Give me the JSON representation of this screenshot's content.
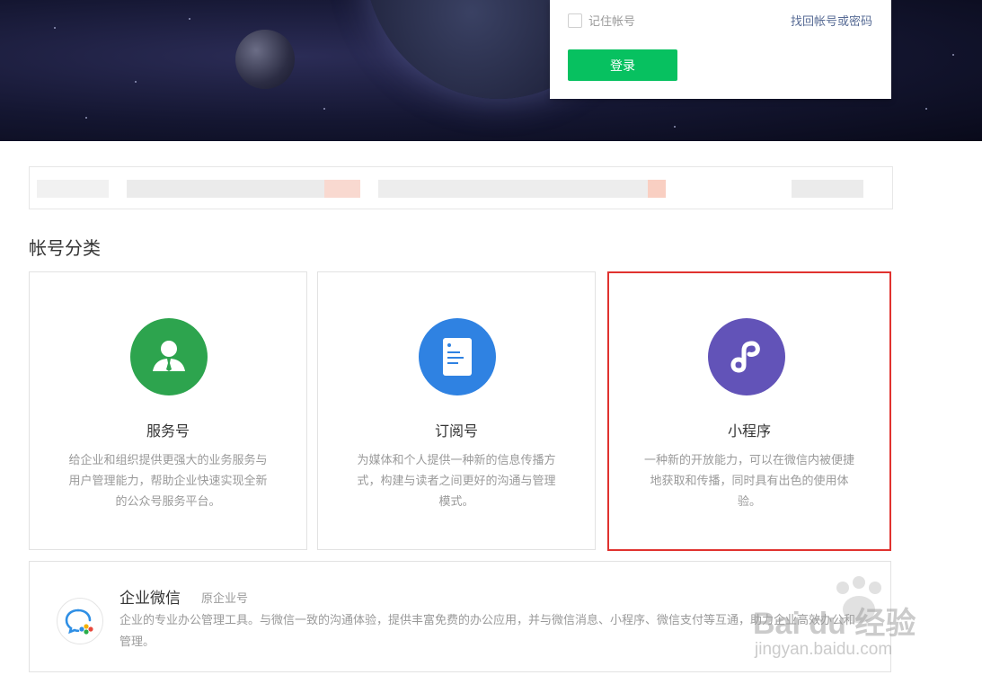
{
  "login": {
    "remember_label": "记住帐号",
    "recover_link": "找回帐号或密码",
    "login_button": "登录"
  },
  "section": {
    "title": "帐号分类"
  },
  "cards": [
    {
      "title": "服务号",
      "desc": "给企业和组织提供更强大的业务服务与用户管理能力，帮助企业快速实现全新的公众号服务平台。",
      "icon": "service-account-icon",
      "color": "#2da44e"
    },
    {
      "title": "订阅号",
      "desc": "为媒体和个人提供一种新的信息传播方式，构建与读者之间更好的沟通与管理模式。",
      "icon": "subscription-document-icon",
      "color": "#2f82e2"
    },
    {
      "title": "小程序",
      "desc": "一种新的开放能力，可以在微信内被便捷地获取和传播，同时具有出色的使用体验。",
      "icon": "mini-program-icon",
      "color": "#6253b8"
    }
  ],
  "wecom": {
    "title": "企业微信",
    "subtitle": "原企业号",
    "desc": "企业的专业办公管理工具。与微信一致的沟通体验，提供丰富免费的办公应用，并与微信消息、小程序、微信支付等互通，助力企业高效办公和管理。",
    "icon": "wecom-logo-icon"
  },
  "watermark": {
    "brand": "Bai du 经验",
    "url": "jingyan.baidu.com"
  },
  "colors": {
    "accent_green": "#07c160",
    "link_blue": "#576b95",
    "highlight_red": "#e0322f"
  }
}
